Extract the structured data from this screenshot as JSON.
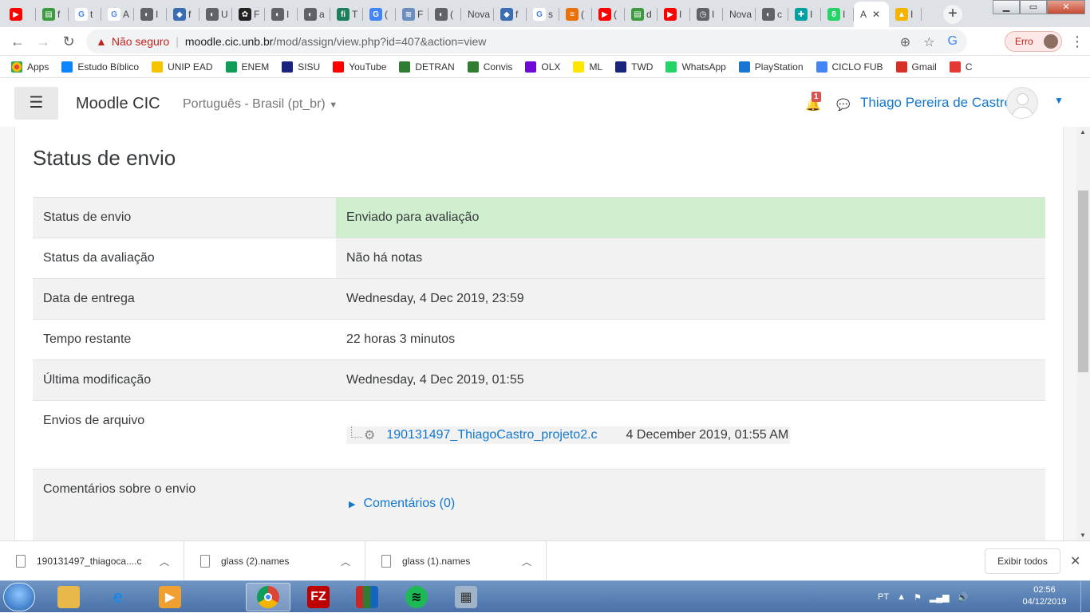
{
  "browser": {
    "tabs": [
      {
        "label": "",
        "color": "#ff0000",
        "glyph": "▶"
      },
      {
        "label": "f",
        "color": "#3c9a41",
        "glyph": "▤"
      },
      {
        "label": "t",
        "color": "#ffffff",
        "glyph": "G"
      },
      {
        "label": "A",
        "color": "#ffffff",
        "glyph": "G"
      },
      {
        "label": "I",
        "color": "#5f6368",
        "glyph": "◐"
      },
      {
        "label": "f",
        "color": "#3b6db3",
        "glyph": "◆"
      },
      {
        "label": "U",
        "color": "#5f6368",
        "glyph": "◐"
      },
      {
        "label": "F",
        "color": "#222222",
        "glyph": "✿"
      },
      {
        "label": "I",
        "color": "#5f6368",
        "glyph": "◐"
      },
      {
        "label": "a",
        "color": "#5f6368",
        "glyph": "◐"
      },
      {
        "label": "T",
        "color": "#1a7f5a",
        "glyph": "fi"
      },
      {
        "label": "(",
        "color": "#4285f4",
        "glyph": "G"
      },
      {
        "label": "F",
        "color": "#6c8ebf",
        "glyph": "≋"
      },
      {
        "label": "(",
        "color": "#5f6368",
        "glyph": "◐"
      },
      {
        "label": "Nova",
        "color": "",
        "glyph": ""
      },
      {
        "label": "f",
        "color": "#3b6db3",
        "glyph": "◆"
      },
      {
        "label": "s",
        "color": "#ffffff",
        "glyph": "G"
      },
      {
        "label": "(",
        "color": "#e8710a",
        "glyph": "≡"
      },
      {
        "label": "(",
        "color": "#ff0000",
        "glyph": "▶"
      },
      {
        "label": "d",
        "color": "#3c9a41",
        "glyph": "▤"
      },
      {
        "label": "I",
        "color": "#ff0000",
        "glyph": "▶"
      },
      {
        "label": "I",
        "color": "#5f6368",
        "glyph": "◷"
      },
      {
        "label": "Nova",
        "color": "",
        "glyph": ""
      },
      {
        "label": "c",
        "color": "#5f6368",
        "glyph": "◐"
      },
      {
        "label": "I",
        "color": "#00a0a0",
        "glyph": "✚"
      },
      {
        "label": "I",
        "color": "#25d366",
        "glyph": "8"
      },
      {
        "label": "A",
        "color": "",
        "glyph": "",
        "active": true
      },
      {
        "label": "I",
        "color": "#f4b400",
        "glyph": "▲"
      }
    ],
    "new_tab_label": "+",
    "window_buttons": {
      "minimize": "▁",
      "maximize": "▭",
      "close": "✕"
    },
    "address": {
      "warning_text": "Não seguro",
      "host": "moodle.cic.unb.br",
      "path": "/mod/assign/view.php?id=407&action=view"
    },
    "profile_pill": "Erro",
    "bookmarks": [
      {
        "label": "Apps",
        "color": "#ea4335"
      },
      {
        "label": "Estudo Bíblico",
        "color": "#0a84ff"
      },
      {
        "label": "UNIP EAD",
        "color": "#f5c400"
      },
      {
        "label": "ENEM",
        "color": "#0f9d58"
      },
      {
        "label": "SISU",
        "color": "#1a237e"
      },
      {
        "label": "YouTube",
        "color": "#ff0000"
      },
      {
        "label": "DETRAN",
        "color": "#2e7d32"
      },
      {
        "label": "Convis",
        "color": "#2e7d32"
      },
      {
        "label": "OLX",
        "color": "#6e0ad6"
      },
      {
        "label": "ML",
        "color": "#ffe600"
      },
      {
        "label": "TWD",
        "color": "#1a237e"
      },
      {
        "label": "WhatsApp",
        "color": "#25d366"
      },
      {
        "label": "PlayStation",
        "color": "#1976d2"
      },
      {
        "label": "CICLO FUB",
        "color": "#4285f4"
      },
      {
        "label": "Gmail",
        "color": "#d93025"
      },
      {
        "label": "C",
        "color": "#e53935"
      }
    ]
  },
  "moodle": {
    "menu_icon": "☰",
    "brand": "Moodle CIC",
    "language": "Português - Brasil (pt_br)",
    "notification_count": "1",
    "user_name": "Thiago Pereira de Castro",
    "section_title": "Status de envio",
    "rows": [
      {
        "label": "Status de envio",
        "value": "Enviado para avaliação"
      },
      {
        "label": "Status da avaliação",
        "value": "Não há notas"
      },
      {
        "label": "Data de entrega",
        "value": "Wednesday, 4 Dec 2019, 23:59"
      },
      {
        "label": "Tempo restante",
        "value": "22 horas 3 minutos"
      },
      {
        "label": "Última modificação",
        "value": "Wednesday, 4 Dec 2019, 01:55"
      },
      {
        "label": "Envios de arquivo",
        "value": ""
      },
      {
        "label": "Comentários sobre o envio",
        "value": ""
      }
    ],
    "file": {
      "name": "190131497_ThiagoCastro_projeto2.c",
      "date": "4 December 2019, 01:55 AM"
    },
    "comments_link": "Comentários (0)"
  },
  "downloads": {
    "items": [
      {
        "name": "190131497_thiagoca....c"
      },
      {
        "name": "glass (2).names"
      },
      {
        "name": "glass (1).names"
      }
    ],
    "show_all": "Exibir todos",
    "close": "✕"
  },
  "taskbar": {
    "language": "PT",
    "time": "02:56",
    "date": "04/12/2019"
  }
}
